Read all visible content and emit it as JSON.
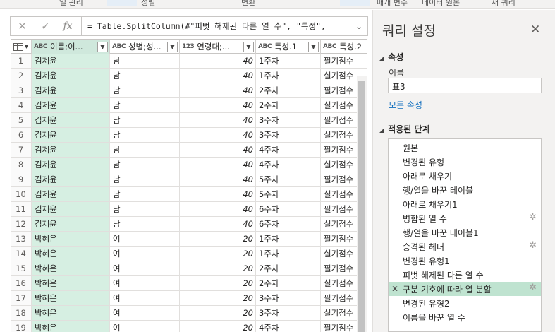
{
  "ribbon": {
    "items": [
      "열 관리",
      "정렬",
      "변환",
      "매개 변수",
      "데이터 원본",
      "새 쿼리"
    ]
  },
  "formula_bar": {
    "cancel_icon": "close-icon",
    "confirm_icon": "check-icon",
    "fx_label": "fx",
    "formula": "= Table.SplitColumn(#\"피벗 해제된 다른 열 수\", \"특성\",",
    "expand_icon": "chevron-down-icon"
  },
  "table": {
    "columns": [
      {
        "type": "ABC",
        "name": "이름;이...",
        "selected": true
      },
      {
        "type": "ABC",
        "name": "성별;성...",
        "selected": false
      },
      {
        "type": "123",
        "name": "연령대;...",
        "selected": false
      },
      {
        "type": "ABC",
        "name": "특성.1",
        "selected": false
      },
      {
        "type": "ABC",
        "name": "특성.2",
        "selected": false
      }
    ],
    "rows": [
      {
        "n": "1",
        "name": "김제윤",
        "gender": "남",
        "age": "40",
        "week": "1주차",
        "score": "필기점수"
      },
      {
        "n": "2",
        "name": "김제윤",
        "gender": "남",
        "age": "40",
        "week": "1주차",
        "score": "실기점수"
      },
      {
        "n": "3",
        "name": "김제윤",
        "gender": "남",
        "age": "40",
        "week": "2주차",
        "score": "필기점수"
      },
      {
        "n": "4",
        "name": "김제윤",
        "gender": "남",
        "age": "40",
        "week": "2주차",
        "score": "실기점수"
      },
      {
        "n": "5",
        "name": "김제윤",
        "gender": "남",
        "age": "40",
        "week": "3주차",
        "score": "필기점수"
      },
      {
        "n": "6",
        "name": "김제윤",
        "gender": "남",
        "age": "40",
        "week": "3주차",
        "score": "실기점수"
      },
      {
        "n": "7",
        "name": "김제윤",
        "gender": "남",
        "age": "40",
        "week": "4주차",
        "score": "필기점수"
      },
      {
        "n": "8",
        "name": "김제윤",
        "gender": "남",
        "age": "40",
        "week": "4주차",
        "score": "실기점수"
      },
      {
        "n": "9",
        "name": "김제윤",
        "gender": "남",
        "age": "40",
        "week": "5주차",
        "score": "필기점수"
      },
      {
        "n": "10",
        "name": "김제윤",
        "gender": "남",
        "age": "40",
        "week": "5주차",
        "score": "실기점수"
      },
      {
        "n": "11",
        "name": "김제윤",
        "gender": "남",
        "age": "40",
        "week": "6주차",
        "score": "필기점수"
      },
      {
        "n": "12",
        "name": "김제윤",
        "gender": "남",
        "age": "40",
        "week": "6주차",
        "score": "실기점수"
      },
      {
        "n": "13",
        "name": "박혜은",
        "gender": "여",
        "age": "20",
        "week": "1주차",
        "score": "필기점수"
      },
      {
        "n": "14",
        "name": "박혜은",
        "gender": "여",
        "age": "20",
        "week": "1주차",
        "score": "실기점수"
      },
      {
        "n": "15",
        "name": "박혜은",
        "gender": "여",
        "age": "20",
        "week": "2주차",
        "score": "필기점수"
      },
      {
        "n": "16",
        "name": "박혜은",
        "gender": "여",
        "age": "20",
        "week": "2주차",
        "score": "실기점수"
      },
      {
        "n": "17",
        "name": "박혜은",
        "gender": "여",
        "age": "20",
        "week": "3주차",
        "score": "필기점수"
      },
      {
        "n": "18",
        "name": "박혜은",
        "gender": "여",
        "age": "20",
        "week": "3주차",
        "score": "실기점수"
      },
      {
        "n": "19",
        "name": "박혜은",
        "gender": "여",
        "age": "20",
        "week": "4주차",
        "score": "필기점수"
      }
    ]
  },
  "query_settings": {
    "title": "쿼리 설정",
    "properties_header": "속성",
    "name_label": "이름",
    "name_value": "표3",
    "all_properties_link": "모든 속성",
    "applied_steps_header": "적용된 단계",
    "steps": [
      {
        "label": "원본",
        "gear": false,
        "active": false
      },
      {
        "label": "변경된 유형",
        "gear": false,
        "active": false
      },
      {
        "label": "아래로 채우기",
        "gear": false,
        "active": false
      },
      {
        "label": "행/열을 바꾼 테이블",
        "gear": false,
        "active": false
      },
      {
        "label": "아래로 채우기1",
        "gear": false,
        "active": false
      },
      {
        "label": "병합된 열 수",
        "gear": true,
        "active": false
      },
      {
        "label": "행/열을 바꾼 테이블1",
        "gear": false,
        "active": false
      },
      {
        "label": "승격된 헤더",
        "gear": true,
        "active": false
      },
      {
        "label": "변경된 유형1",
        "gear": false,
        "active": false
      },
      {
        "label": "피벗 해제된 다른 열 수",
        "gear": false,
        "active": false
      },
      {
        "label": "구분 기호에 따라 열 분할",
        "gear": true,
        "active": true
      },
      {
        "label": "변경된 유형2",
        "gear": false,
        "active": false
      },
      {
        "label": "이름을 바꾼 열 수",
        "gear": false,
        "active": false
      }
    ]
  },
  "colors": {
    "selected_column": "#d6efe2",
    "active_step": "#bfe3d0",
    "link": "#106ebe"
  }
}
